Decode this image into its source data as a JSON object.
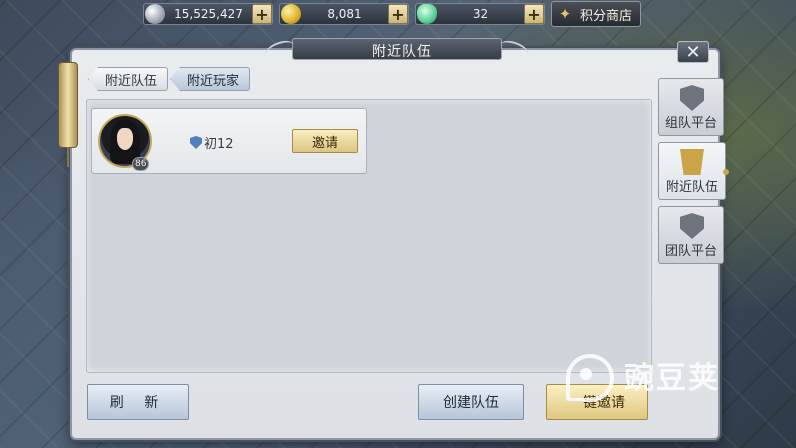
{
  "currencies": [
    {
      "icon": "silver-coin-icon",
      "value": "15,525,427"
    },
    {
      "icon": "gold-coin-icon",
      "value": "8,081"
    },
    {
      "icon": "ingot-icon",
      "value": "32"
    }
  ],
  "plus_label": "+",
  "shop": {
    "label": "积分商店",
    "icon": "shop-icon"
  },
  "dialog": {
    "title": "附近队伍",
    "close_label": "✕"
  },
  "tabs": [
    {
      "label": "附近队伍",
      "active": false
    },
    {
      "label": "附近玩家",
      "active": true
    }
  ],
  "players": [
    {
      "level": "86",
      "rank": "初12",
      "invite_label": "邀请"
    }
  ],
  "buttons": {
    "refresh": "刷 新",
    "create_team": "创建队伍",
    "invite_all": "一键邀请"
  },
  "side_tabs": [
    {
      "label": "组队平台",
      "icon": "shield-icon",
      "active": false
    },
    {
      "label": "附近队伍",
      "icon": "flag-icon",
      "active": true
    },
    {
      "label": "团队平台",
      "icon": "shield-icon",
      "active": false
    }
  ],
  "watermark": {
    "text": "豌豆荚"
  },
  "colors": {
    "accent_gold": "#dcc583",
    "panel": "#e9ecef",
    "tab_active": "#b8c7d8"
  }
}
